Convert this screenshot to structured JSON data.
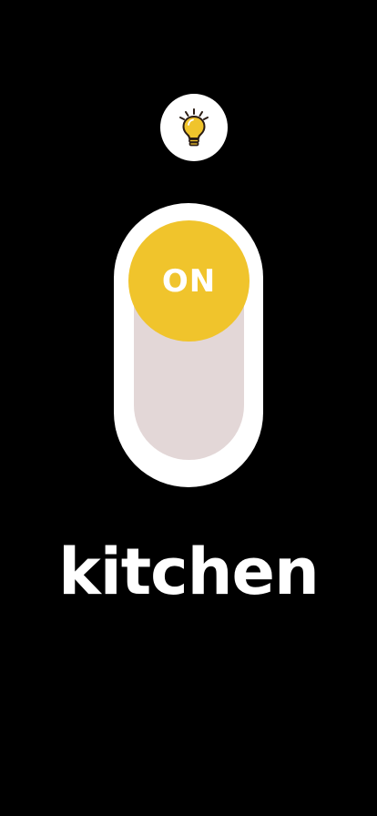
{
  "colors": {
    "background": "#000000",
    "switch_frame": "#ffffff",
    "switch_track": "#e3d7d7",
    "knob": "#f0c42c",
    "bulb": "#f0c42c",
    "text": "#ffffff"
  },
  "header": {
    "icon": "lightbulb-icon"
  },
  "switch": {
    "state": "on",
    "knob_label": "ON"
  },
  "room": {
    "name": "kitchen"
  }
}
